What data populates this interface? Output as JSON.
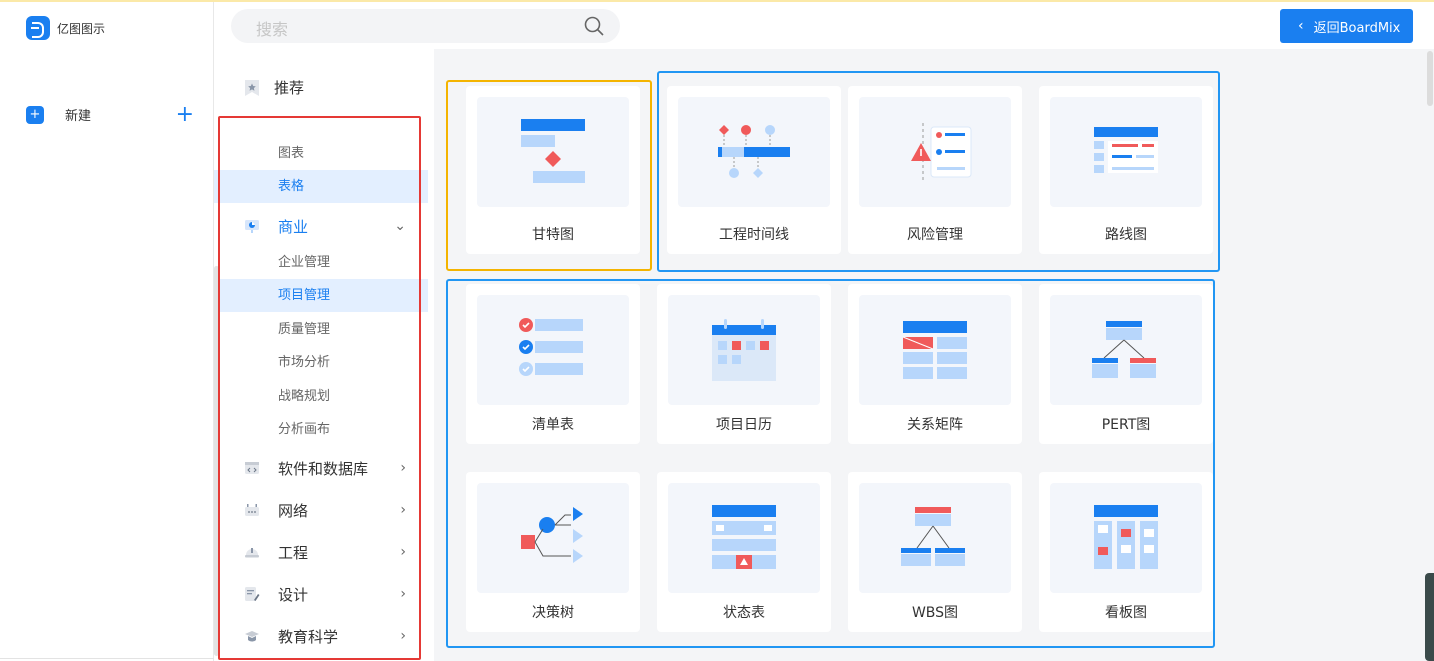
{
  "app": {
    "name": "亿图图示"
  },
  "sidebar": {
    "new_label": "新建",
    "new_plus": "+"
  },
  "search": {
    "placeholder": "搜索"
  },
  "back_button": {
    "label": "返回BoardMix",
    "chevron": "‹"
  },
  "categories": {
    "top": {
      "label": "推荐",
      "icon": "star-icon"
    },
    "items": [
      {
        "kind": "sub",
        "label": "图表",
        "active": false
      },
      {
        "kind": "sub",
        "label": "表格",
        "active": true
      },
      {
        "kind": "main",
        "label": "商业",
        "icon": "business-icon",
        "arrow": "⌄",
        "open": true
      },
      {
        "kind": "sub",
        "label": "企业管理",
        "active": false
      },
      {
        "kind": "sub",
        "label": "项目管理",
        "active": true
      },
      {
        "kind": "sub",
        "label": "质量管理",
        "active": false
      },
      {
        "kind": "sub",
        "label": "市场分析",
        "active": false
      },
      {
        "kind": "sub",
        "label": "战略规划",
        "active": false
      },
      {
        "kind": "sub",
        "label": "分析画布",
        "active": false
      },
      {
        "kind": "main",
        "label": "软件和数据库",
        "icon": "code-icon",
        "arrow": "›"
      },
      {
        "kind": "main",
        "label": "网络",
        "icon": "network-icon",
        "arrow": "›"
      },
      {
        "kind": "main",
        "label": "工程",
        "icon": "helmet-icon",
        "arrow": "›"
      },
      {
        "kind": "main",
        "label": "设计",
        "icon": "design-icon",
        "arrow": "›"
      },
      {
        "kind": "main",
        "label": "教育科学",
        "icon": "graduation-icon",
        "arrow": "›"
      }
    ]
  },
  "templates": [
    {
      "label": "甘特图",
      "icon": "gantt-chart-icon"
    },
    {
      "label": "工程时间线",
      "icon": "timeline-icon"
    },
    {
      "label": "风险管理",
      "icon": "risk-icon"
    },
    {
      "label": "路线图",
      "icon": "roadmap-icon"
    },
    {
      "label": "清单表",
      "icon": "checklist-icon"
    },
    {
      "label": "项目日历",
      "icon": "calendar-icon"
    },
    {
      "label": "关系矩阵",
      "icon": "matrix-icon"
    },
    {
      "label": "PERT图",
      "icon": "pert-icon"
    },
    {
      "label": "决策树",
      "icon": "decision-tree-icon"
    },
    {
      "label": "状态表",
      "icon": "status-table-icon"
    },
    {
      "label": "WBS图",
      "icon": "wbs-icon"
    },
    {
      "label": "看板图",
      "icon": "kanban-icon"
    }
  ],
  "colors": {
    "accent": "#1a7ff0",
    "light_blue": "#b7d6fb",
    "red": "#f05a5a",
    "highlight_yellow": "#f4b400",
    "highlight_blue": "#2196f3",
    "highlight_red": "#e53935"
  }
}
